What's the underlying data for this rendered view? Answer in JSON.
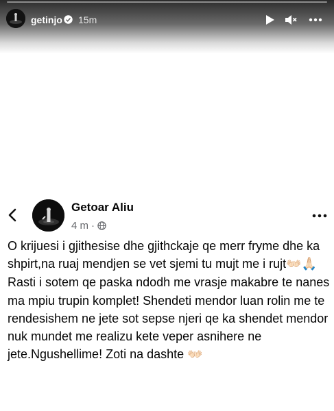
{
  "story": {
    "username": "getinjo",
    "time": "15m",
    "progress": 0.0,
    "icons": {
      "verified": "verified-badge-icon",
      "play": "play-icon",
      "mute": "mute-icon",
      "more": "more-icon"
    }
  },
  "post": {
    "author": "Getoar Aliu",
    "time": "4 m",
    "separator": "·",
    "text_part1": "O krijuesi i gjithesise dhe gjithckaje qe merr fryme dhe ka shpirt,na ruaj mendjen se vet sjemi tu mujt me i rujt",
    "emoji1": "👐🏻",
    "emoji2": "🙏🏻",
    "text_part2": " Rasti i sotem qe paska ndodh me vrasje makabre te nanes ma mpiu trupin komplet! Shendeti mendor luan rolin me te rendesishem ne jete sot sepse njeri qe ka shendet mendor nuk mundet me realizu kete veper asnihere ne jete.Ngushellime! Zoti na dashte ",
    "emoji3": "👐🏻"
  },
  "colors": {
    "text": "#050505",
    "meta": "#65676b",
    "background": "#ffffff"
  }
}
